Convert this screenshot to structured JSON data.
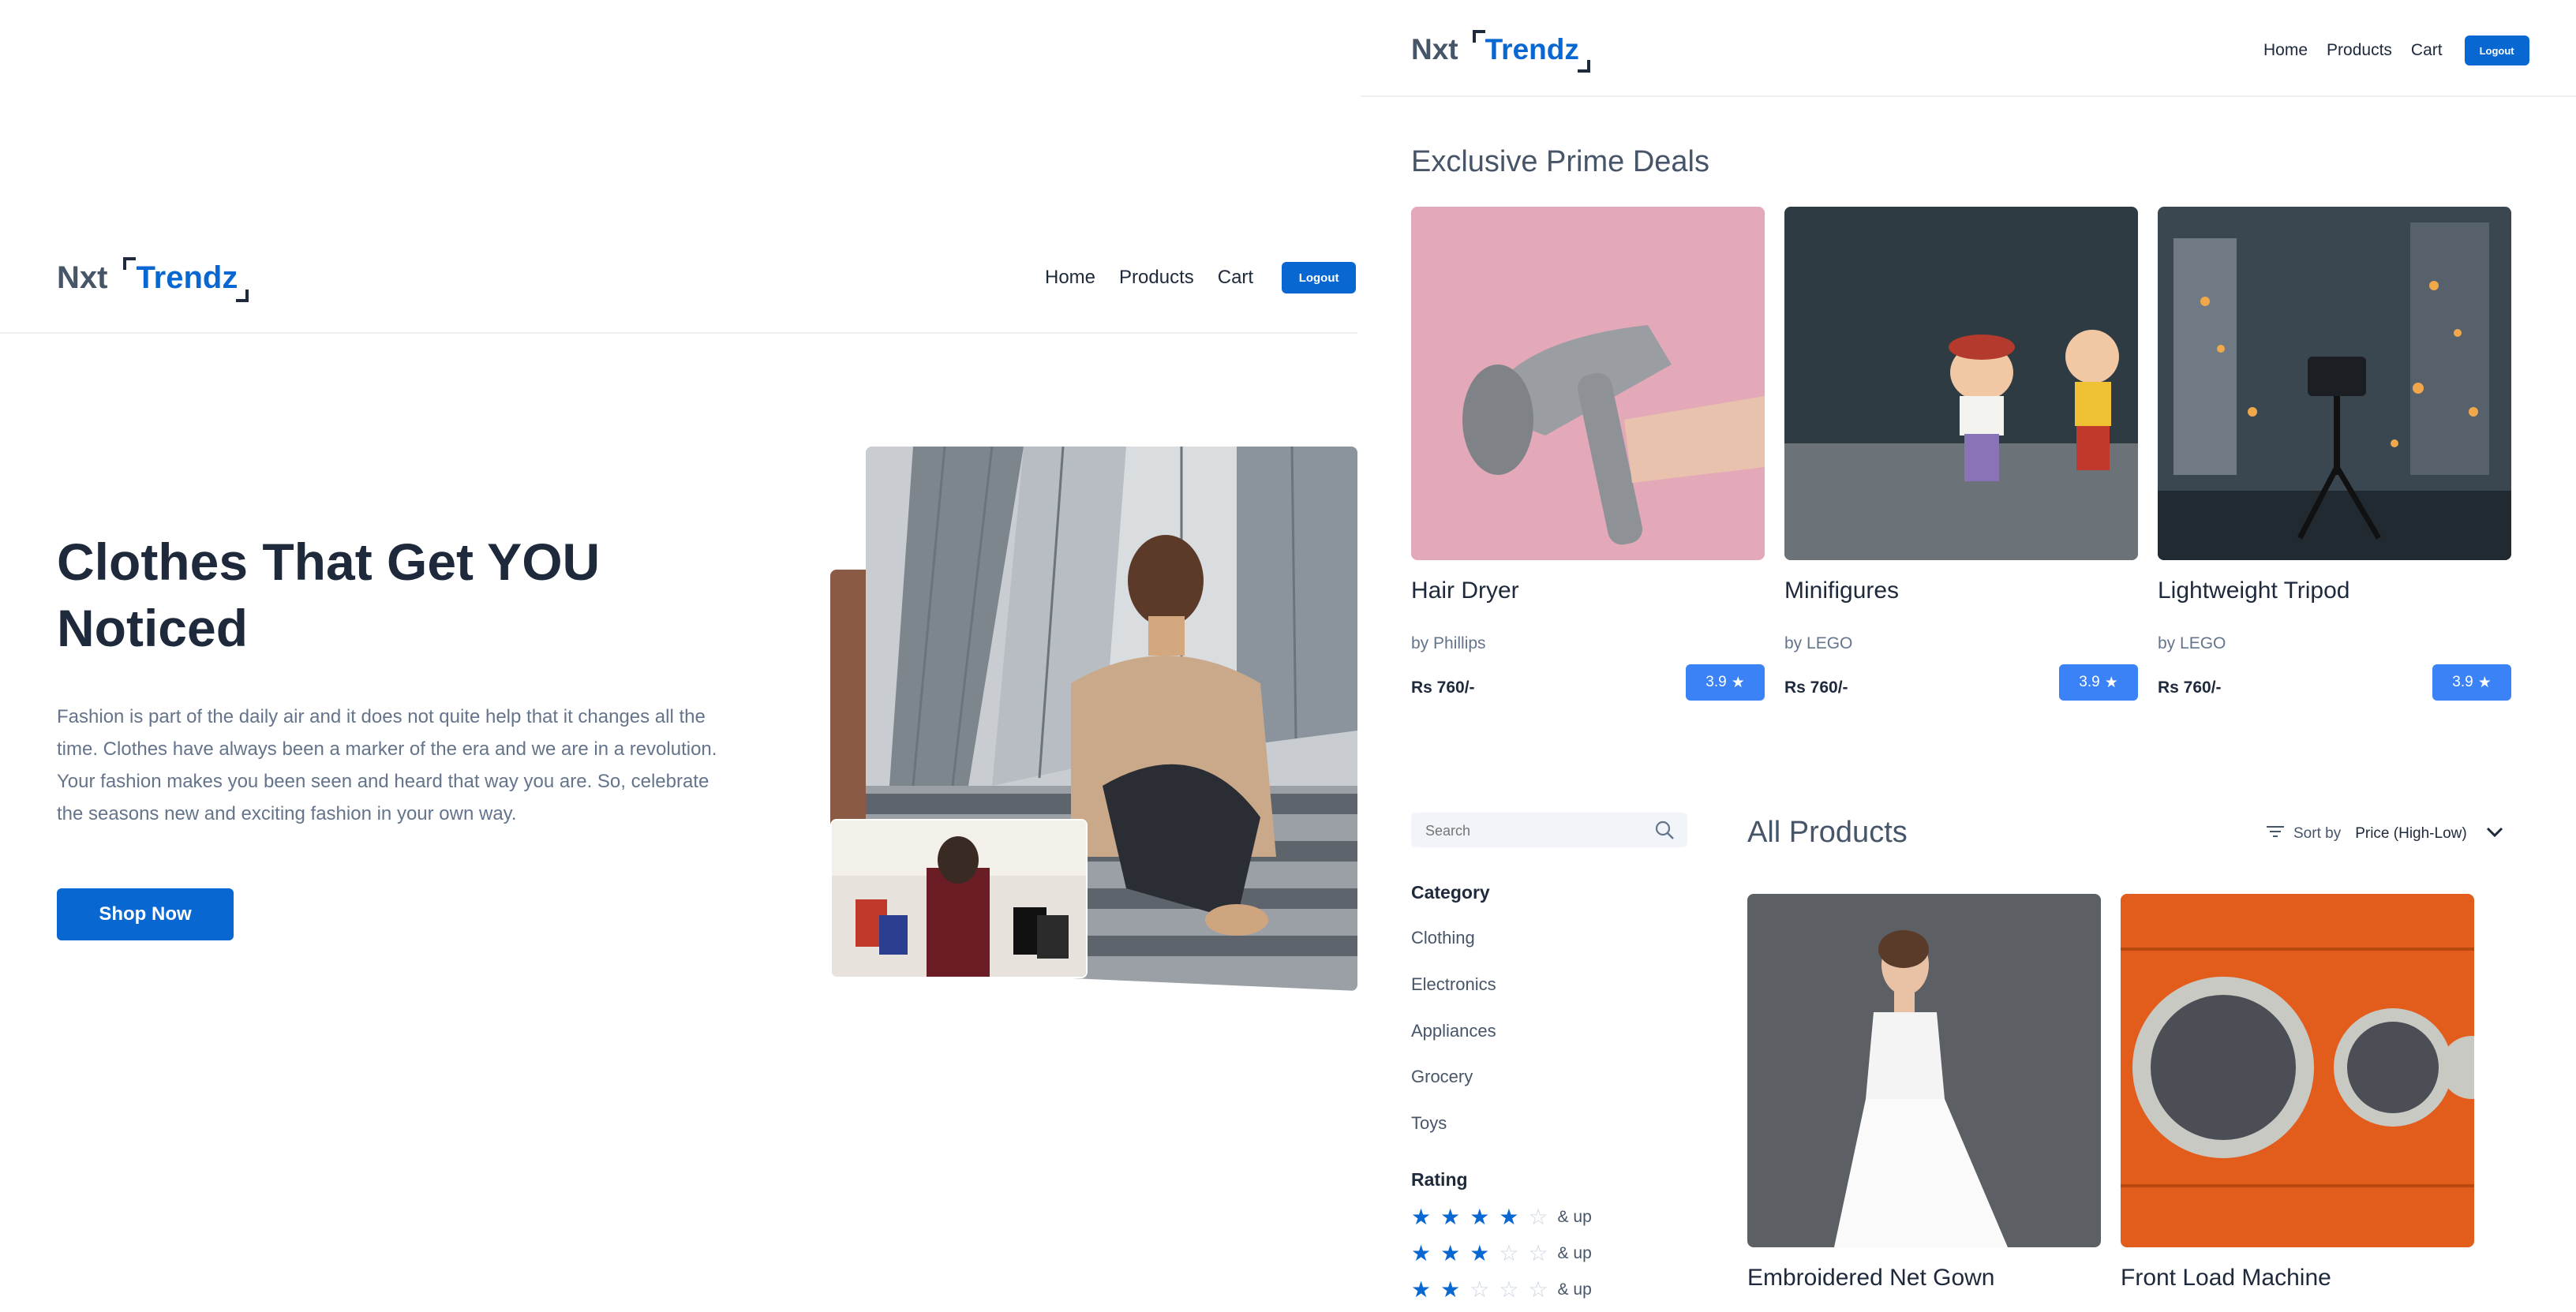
{
  "left": {
    "logo": {
      "nxt": "Nxt",
      "trendz": "Trendz"
    },
    "nav": {
      "home": "Home",
      "products": "Products",
      "cart": "Cart",
      "logout": "Logout"
    },
    "hero": {
      "title": "Clothes That Get YOU Noticed",
      "description": "Fashion is part of the daily air and it does not quite help that it changes all the time. Clothes have always been a marker of the era and we are in a revolution. Your fashion makes you been seen and heard that way you are. So, celebrate the seasons new and exciting fashion in your own way.",
      "cta": "Shop Now"
    }
  },
  "right": {
    "logo": {
      "nxt": "Nxt",
      "trendz": "Trendz"
    },
    "nav": {
      "home": "Home",
      "products": "Products",
      "cart": "Cart",
      "logout": "Logout"
    },
    "prime": {
      "heading": "Exclusive Prime Deals",
      "items": [
        {
          "title": "Hair Dryer",
          "brand": "by Phillips",
          "price": "Rs 760/-",
          "rating": "3.9"
        },
        {
          "title": "Minifigures",
          "brand": "by LEGO",
          "price": "Rs 760/-",
          "rating": "3.9"
        },
        {
          "title": "Lightweight Tripod",
          "brand": "by LEGO",
          "price": "Rs 760/-",
          "rating": "3.9"
        }
      ]
    },
    "filters": {
      "search_placeholder": "Search",
      "category_heading": "Category",
      "categories": [
        "Clothing",
        "Electronics",
        "Appliances",
        "Grocery",
        "Toys"
      ],
      "rating_heading": "Rating",
      "rating_rows": [
        {
          "stars": 4,
          "label": "& up"
        },
        {
          "stars": 3,
          "label": "& up"
        },
        {
          "stars": 2,
          "label": "& up"
        }
      ]
    },
    "all_products": {
      "heading": "All Products",
      "sort_label": "Sort by",
      "sort_value": "Price (High-Low)",
      "items": [
        {
          "title": "Embroidered Net Gown"
        },
        {
          "title": "Front Load Machine"
        }
      ]
    }
  },
  "colors": {
    "primary": "#0967d2",
    "rating_badge": "#3b82f6",
    "text_dark": "#1e293b",
    "text_muted": "#64748b"
  }
}
